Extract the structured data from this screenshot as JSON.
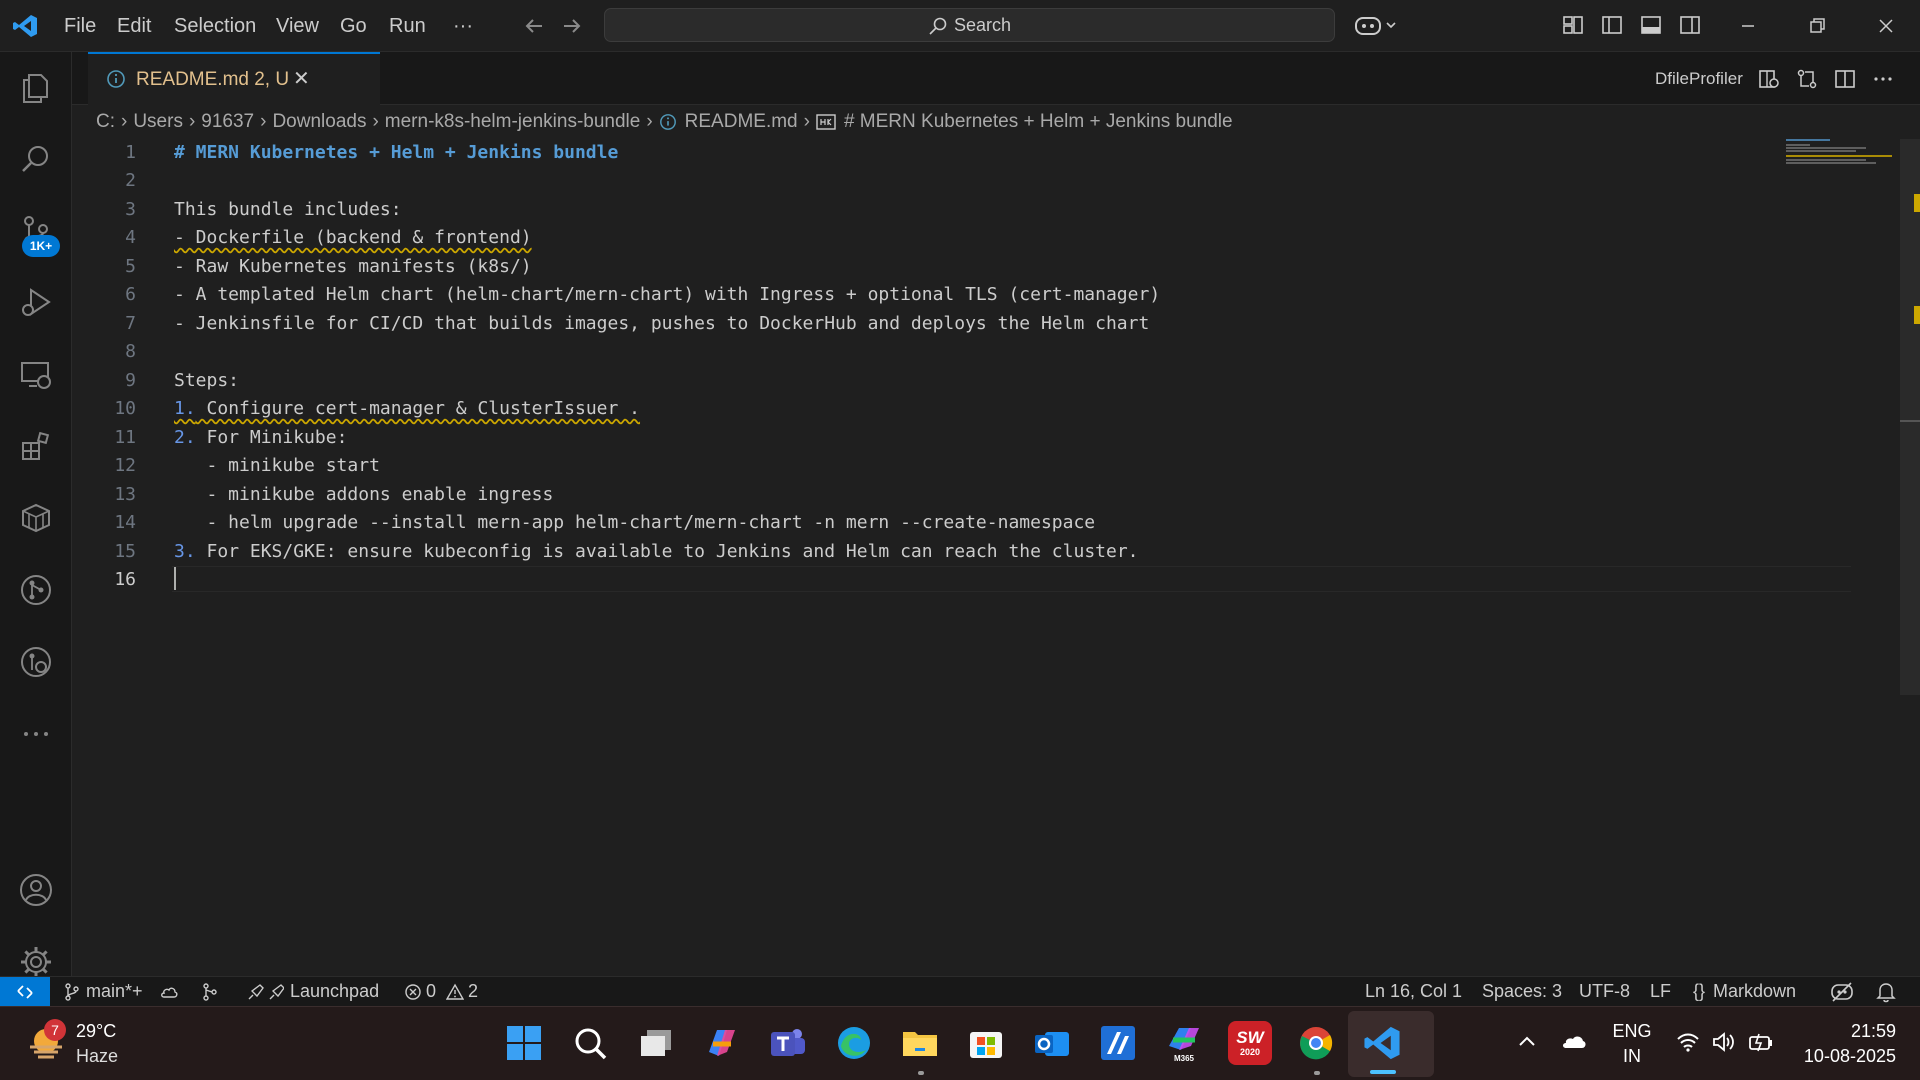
{
  "menu": {
    "file": "File",
    "edit": "Edit",
    "selection": "Selection",
    "view": "View",
    "go": "Go",
    "run": "Run",
    "more": "···"
  },
  "search": {
    "label": "Search"
  },
  "activity": {
    "badge": "1K+"
  },
  "tab": {
    "label": "README.md  2, U",
    "close": "✕"
  },
  "right_toolbar": {
    "profiler": "DfileProfiler"
  },
  "breadcrumb": [
    "C:",
    "Users",
    "91637",
    "Downloads",
    "mern-k8s-helm-jenkins-bundle",
    "README.md",
    "# MERN Kubernetes + Helm + Jenkins bundle"
  ],
  "lines": [
    {
      "n": "1",
      "t": "# MERN Kubernetes + Helm + Jenkins bundle"
    },
    {
      "n": "2",
      "t": ""
    },
    {
      "n": "3",
      "t": "This bundle includes:"
    },
    {
      "n": "4",
      "t": "- Dockerfile (backend & frontend)"
    },
    {
      "n": "5",
      "t": "- Raw Kubernetes manifests (k8s/)"
    },
    {
      "n": "6",
      "t": "- A templated Helm chart (helm-chart/mern-chart) with Ingress + optional TLS (cert-manager)"
    },
    {
      "n": "7",
      "t": "- Jenkinsfile for CI/CD that builds images, pushes to DockerHub and deploys the Helm chart"
    },
    {
      "n": "8",
      "t": ""
    },
    {
      "n": "9",
      "t": "Steps:"
    },
    {
      "n": "10",
      "p": "1.",
      "t": " Configure cert-manager & ClusterIssuer ."
    },
    {
      "n": "11",
      "p": "2.",
      "t": " For Minikube:"
    },
    {
      "n": "12",
      "t": "   - minikube start"
    },
    {
      "n": "13",
      "t": "   - minikube addons enable ingress"
    },
    {
      "n": "14",
      "t": "   - helm upgrade --install mern-app helm-chart/mern-chart -n mern --create-namespace"
    },
    {
      "n": "15",
      "p": "3.",
      "t": " For EKS/GKE: ensure kubeconfig is available to Jenkins and Helm can reach the cluster."
    },
    {
      "n": "16",
      "t": ""
    }
  ],
  "status": {
    "branch": "main*+",
    "launchpad": "Launchpad",
    "errors": "0",
    "warnings": "2",
    "position": "Ln 16, Col 1",
    "spaces": "Spaces: 3",
    "encoding": "UTF-8",
    "eol": "LF",
    "language": "Markdown"
  },
  "taskbar": {
    "weather_temp": "29°C",
    "weather_desc": "Haze",
    "weather_badge": "7",
    "lang1": "ENG",
    "lang2": "IN",
    "time": "21:59",
    "date": "10-08-2025",
    "m365_label": "M365",
    "sw_label": "SW",
    "sw_year": "2020"
  },
  "colors": {
    "accent": "#0078d4",
    "modified": "#e2c08d",
    "heading": "#569cd6",
    "warning": "#cca700"
  }
}
